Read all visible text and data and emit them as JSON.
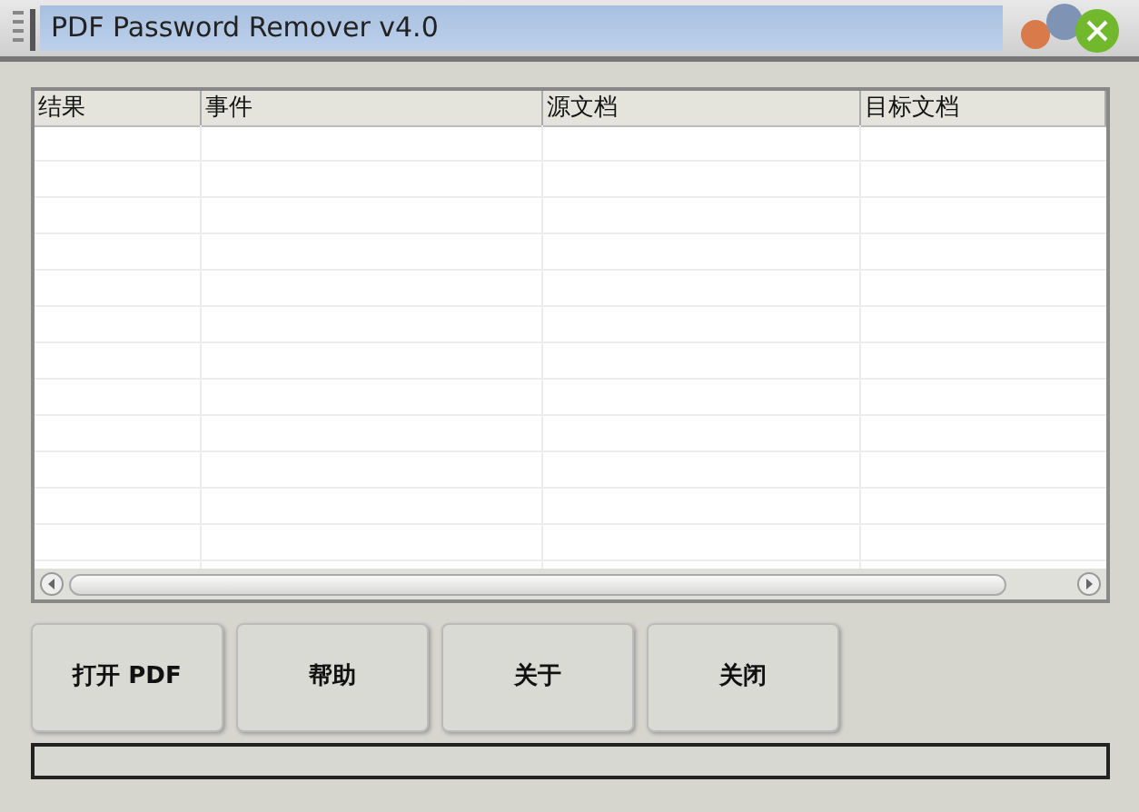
{
  "window": {
    "title": "PDF Password Remover v4.0"
  },
  "table": {
    "columns": [
      "结果",
      "事件",
      "源文档",
      "目标文档"
    ]
  },
  "buttons": [
    "打开 PDF",
    "帮助",
    "关于",
    "关闭"
  ]
}
